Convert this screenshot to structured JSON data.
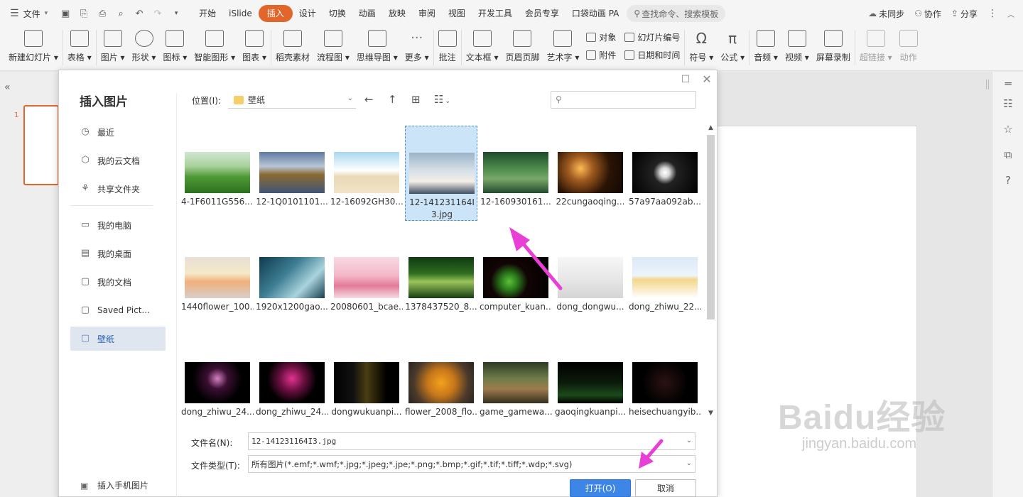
{
  "menubar": {
    "file_label": "文件",
    "tabs": [
      "开始",
      "iSlide",
      "插入",
      "设计",
      "切换",
      "动画",
      "放映",
      "审阅",
      "视图",
      "开发工具",
      "会员专享",
      "口袋动画 PA"
    ],
    "active_tab": "插入",
    "search_placeholder": "查找命令、搜索模板",
    "sync_label": "未同步",
    "collab_label": "协作",
    "share_label": "分享"
  },
  "ribbon": {
    "new_slide": "新建幻灯片",
    "table": "表格",
    "picture": "图片",
    "shape": "形状",
    "icon": "图标",
    "smart_graphic": "智能图形",
    "chart": "图表",
    "material": "稻壳素材",
    "flowchart": "流程图",
    "mindmap": "思维导图",
    "more": "更多",
    "comment": "批注",
    "textbox": "文本框",
    "header_footer": "页眉页脚",
    "wordart": "艺术字",
    "object": "对象",
    "attachment": "附件",
    "slide_number": "幻灯片编号",
    "date_time": "日期和时间",
    "symbol": "符号",
    "formula": "公式",
    "audio": "音频",
    "video": "视频",
    "screen_record": "屏幕录制",
    "hyperlink": "超链接",
    "action": "动作"
  },
  "slides": {
    "number": "1"
  },
  "dialog": {
    "title": "插入图片",
    "nav_items": [
      {
        "label": "最近",
        "icon": "clock-icon"
      },
      {
        "label": "我的云文档",
        "icon": "cloud-doc-icon"
      },
      {
        "label": "共享文件夹",
        "icon": "share-folder-icon"
      },
      {
        "label": "我的电脑",
        "icon": "computer-icon"
      },
      {
        "label": "我的桌面",
        "icon": "desktop-icon"
      },
      {
        "label": "我的文档",
        "icon": "documents-icon"
      },
      {
        "label": "Saved Pict...",
        "icon": "folder-icon"
      },
      {
        "label": "壁纸",
        "icon": "folder-icon"
      }
    ],
    "nav_active": "壁纸",
    "insert_phone": "插入手机图片",
    "location_label": "位置(I):",
    "location_value": "壁纸",
    "search_placeholder": "",
    "files": [
      "4-1F6011G556....",
      "12-1Q0101101...",
      "12-16092GH30...",
      "12-141231164I3.jpg",
      "12-160930161...",
      "22cungaoqing...",
      "57a97aa092ab...",
      "1440flower_100...",
      "1920x1200gao...",
      "20080601_bcae...",
      "1378437520_8...",
      "computer_kuan...",
      "dong_dongwu...",
      "dong_zhiwu_22...",
      "dong_zhiwu_24...",
      "dong_zhiwu_24...",
      "dongwukuanpi...",
      "flower_2008_flo...",
      "game_gamewa...",
      "gaoqingkuanpi...",
      "heisechuangyib..."
    ],
    "selected_index": 3,
    "filename_label": "文件名(N):",
    "filename_value": "12-141231164I3.jpg",
    "filetype_label": "文件类型(T):",
    "filetype_value": "所有图片(*.emf;*.wmf;*.jpg;*.jpeg;*.jpe;*.png;*.bmp;*.gif;*.tif;*.tiff;*.wdp;*.svg)",
    "open_button": "打开(O)",
    "cancel_button": "取消"
  },
  "watermark": {
    "logo": "Baidu经验",
    "url": "jingyan.baidu.com"
  },
  "colors": {
    "accent": "#e2662c",
    "primary_button": "#3d86e8",
    "annotation_arrow": "#e83fd6"
  }
}
